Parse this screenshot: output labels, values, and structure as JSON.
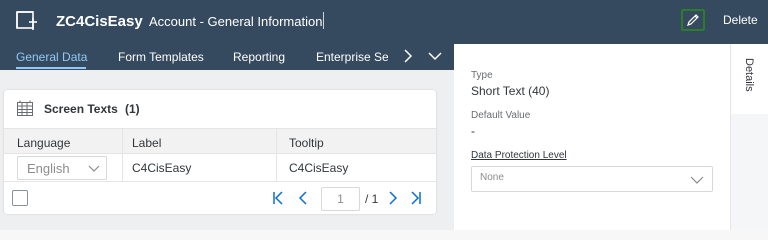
{
  "header": {
    "object_id": "ZC4CisEasy",
    "object_title": "Account - General Information",
    "edit_icon": "pencil-icon",
    "delete_label": "Delete"
  },
  "tabs": [
    {
      "label": "General Data",
      "active": true
    },
    {
      "label": "Form Templates",
      "active": false
    },
    {
      "label": "Reporting",
      "active": false
    },
    {
      "label": "Enterprise Se",
      "active": false
    }
  ],
  "card": {
    "title": "Screen Texts",
    "count": "(1)",
    "columns": [
      "Language",
      "Label",
      "Tooltip"
    ],
    "rows": [
      {
        "language": "English",
        "label": "C4CisEasy",
        "tooltip": "C4CisEasy"
      }
    ],
    "pagination": {
      "current_page": "1",
      "total": "/ 1"
    }
  },
  "details": {
    "type_label": "Type",
    "type_value": "Short Text (40)",
    "default_label": "Default Value",
    "default_value": "-",
    "dp_label": "Data Protection Level",
    "dp_value": "None"
  },
  "side_tab": {
    "label": "Details"
  },
  "colors": {
    "header_bg": "#354a5f",
    "active_tab": "#91c8f6",
    "edit_border": "#2b7c2b",
    "pagination_icon": "#0a6ed1"
  }
}
